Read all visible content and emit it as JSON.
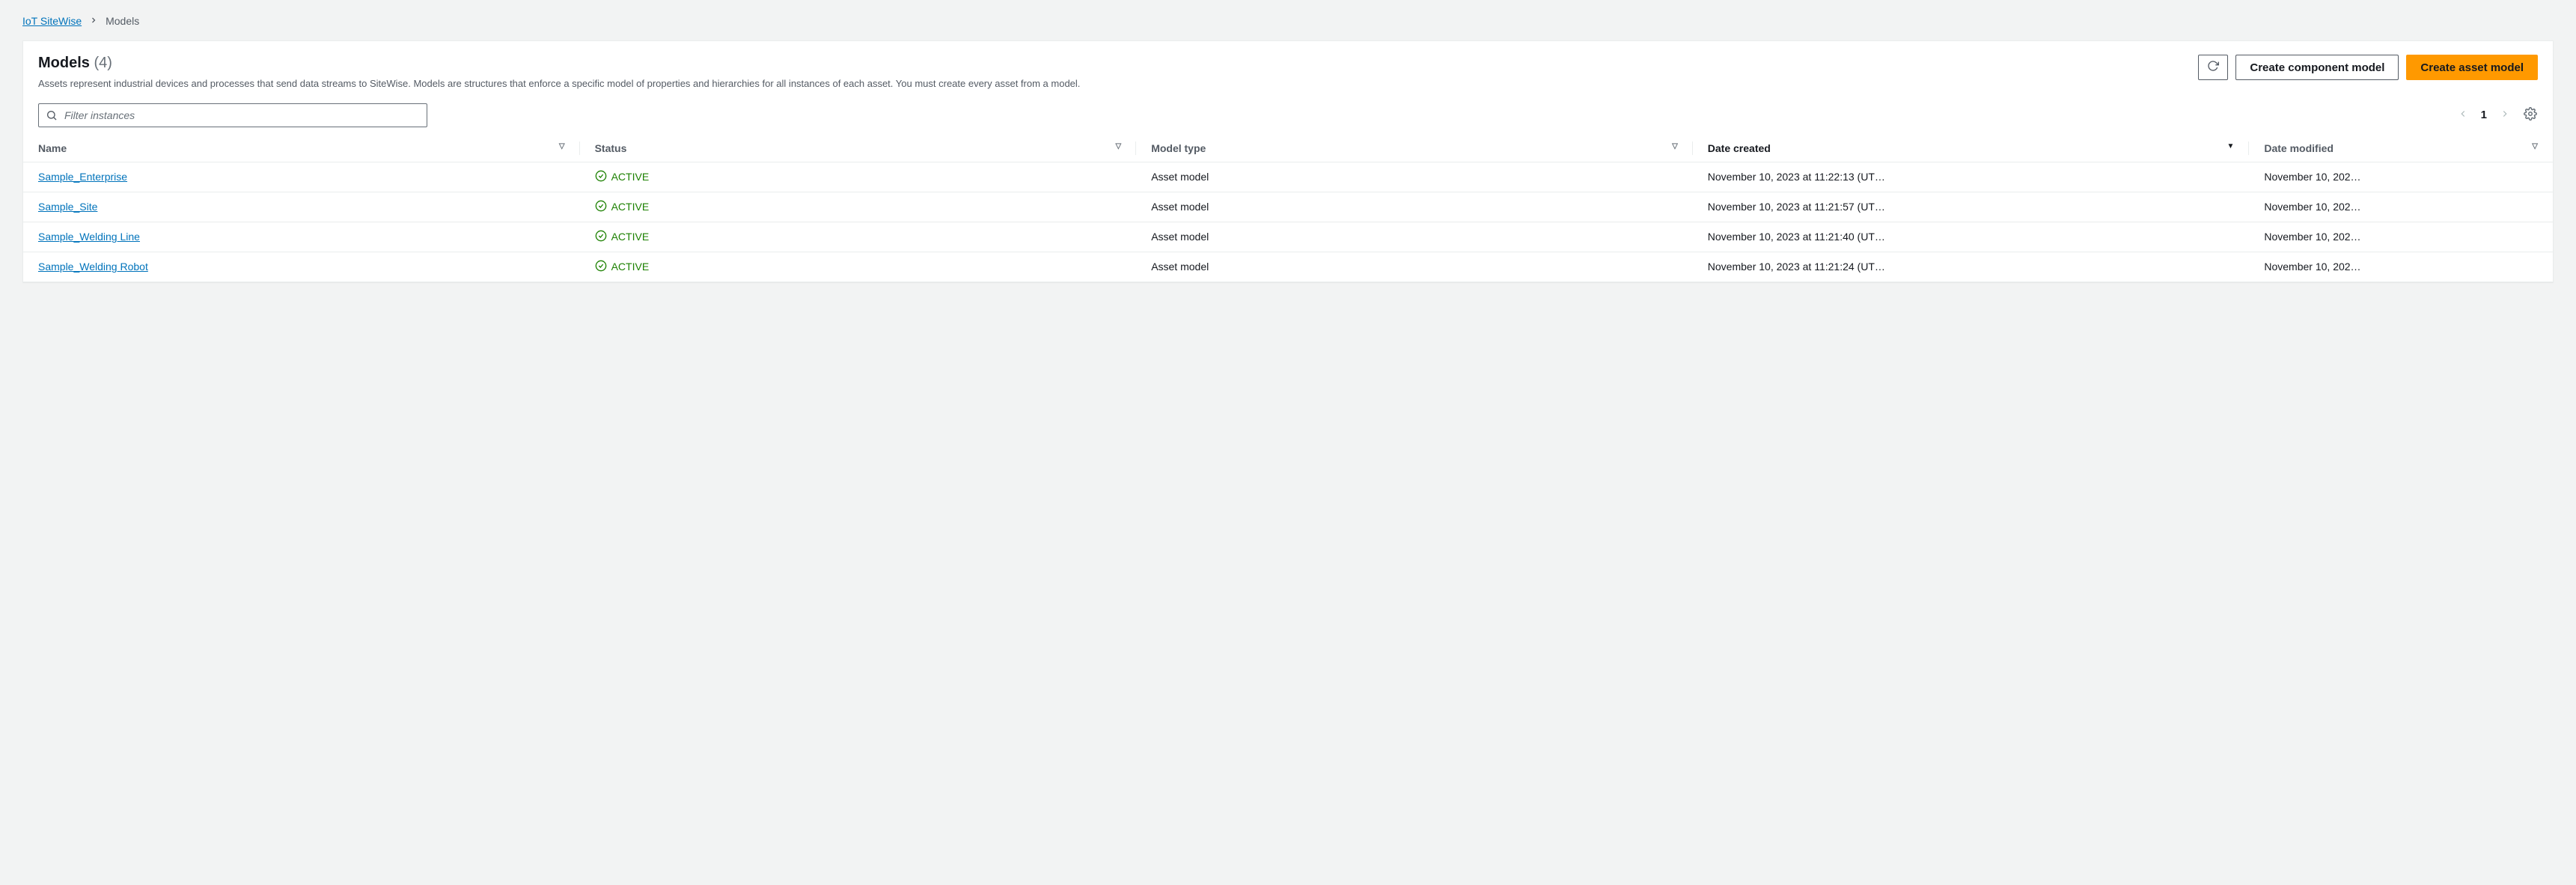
{
  "breadcrumb": {
    "root": "IoT SiteWise",
    "current": "Models"
  },
  "header": {
    "title": "Models",
    "count": "(4)",
    "description": "Assets represent industrial devices and processes that send data streams to SiteWise. Models are structures that enforce a specific model of properties and hierarchies for all instances of each asset. You must create every asset from a model.",
    "btn_component": "Create component model",
    "btn_asset": "Create asset model"
  },
  "search": {
    "placeholder": "Filter instances"
  },
  "pagination": {
    "page": "1"
  },
  "columns": {
    "name": "Name",
    "status": "Status",
    "type": "Model type",
    "created": "Date created",
    "modified": "Date modified"
  },
  "rows": [
    {
      "name": "Sample_Enterprise",
      "status": "ACTIVE",
      "type": "Asset model",
      "created": "November 10, 2023 at 11:22:13 (UT…",
      "modified": "November 10, 202…"
    },
    {
      "name": "Sample_Site",
      "status": "ACTIVE",
      "type": "Asset model",
      "created": "November 10, 2023 at 11:21:57 (UT…",
      "modified": "November 10, 202…"
    },
    {
      "name": "Sample_Welding Line",
      "status": "ACTIVE",
      "type": "Asset model",
      "created": "November 10, 2023 at 11:21:40 (UT…",
      "modified": "November 10, 202…"
    },
    {
      "name": "Sample_Welding Robot",
      "status": "ACTIVE",
      "type": "Asset model",
      "created": "November 10, 2023 at 11:21:24 (UT…",
      "modified": "November 10, 202…"
    }
  ]
}
